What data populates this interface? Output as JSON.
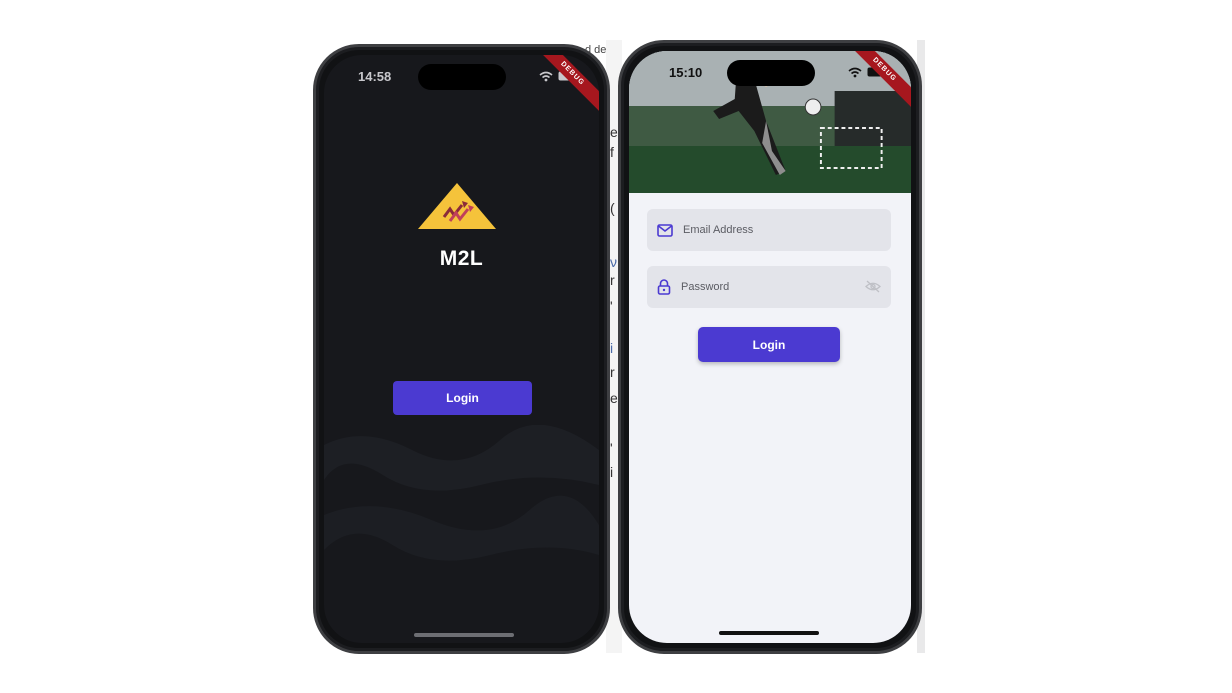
{
  "background": {
    "top_text": "d de",
    "side_letters": [
      "e",
      "f",
      "(",
      "ν",
      "r",
      "'",
      "i",
      "r",
      "e",
      "'",
      "i"
    ]
  },
  "left_phone": {
    "status_time": "14:58",
    "debug_label": "DEBUG",
    "brand_name": "M2L",
    "login_label": "Login",
    "colors": {
      "background": "#17181c",
      "accent": "#4b3ad1",
      "logo": "#f5c33b"
    }
  },
  "right_phone": {
    "status_time": "15:10",
    "debug_label": "DEBUG",
    "email": {
      "placeholder": "Email Address",
      "value": ""
    },
    "password": {
      "placeholder": "Password",
      "value": ""
    },
    "login_label": "Login",
    "colors": {
      "background": "#f2f3f8",
      "field": "#e3e4ea",
      "accent": "#4b3ad1"
    }
  }
}
